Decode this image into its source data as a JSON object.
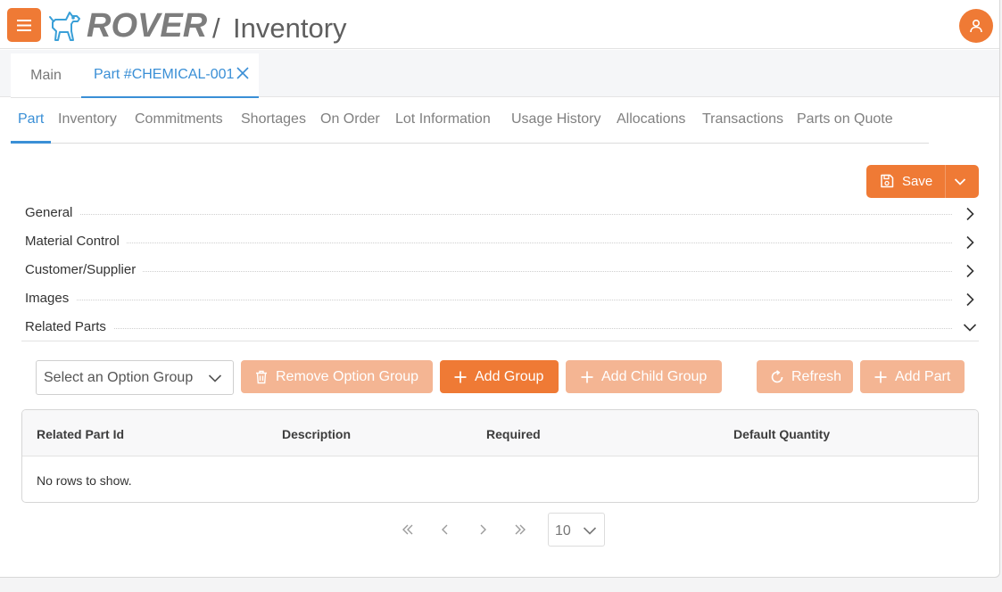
{
  "header": {
    "brand": "ROVER",
    "separator": "/",
    "module": "Inventory"
  },
  "doc_tabs": [
    {
      "label": "Main",
      "active": false
    },
    {
      "label": "Part #CHEMICAL-001",
      "active": true,
      "closable": true
    }
  ],
  "sub_tabs": [
    {
      "label": "Part",
      "active": true
    },
    {
      "label": "Inventory"
    },
    {
      "label": "Commitments"
    },
    {
      "label": "Shortages"
    },
    {
      "label": "On Order"
    },
    {
      "label": "Lot Information"
    },
    {
      "label": "Usage History"
    },
    {
      "label": "Allocations"
    },
    {
      "label": "Transactions"
    },
    {
      "label": "Parts on Quote"
    }
  ],
  "save": {
    "label": "Save"
  },
  "sections": [
    {
      "title": "General",
      "expanded": false
    },
    {
      "title": "Material Control",
      "expanded": false
    },
    {
      "title": "Customer/Supplier",
      "expanded": false
    },
    {
      "title": "Images",
      "expanded": false
    },
    {
      "title": "Related Parts",
      "expanded": true
    }
  ],
  "toolbar": {
    "option_group_placeholder": "Select an Option Group",
    "remove_option_group": "Remove Option Group",
    "add_group": "Add Group",
    "add_child_group": "Add Child Group",
    "refresh": "Refresh",
    "add_part": "Add Part"
  },
  "grid": {
    "columns": [
      "Related Part Id",
      "Description",
      "Required",
      "Default Quantity"
    ],
    "empty_message": "No rows to show."
  },
  "pager": {
    "page_size": "10"
  },
  "colors": {
    "accent": "#ef7a35",
    "accent_disabled": "#f4b593",
    "link": "#3a8fd6"
  }
}
